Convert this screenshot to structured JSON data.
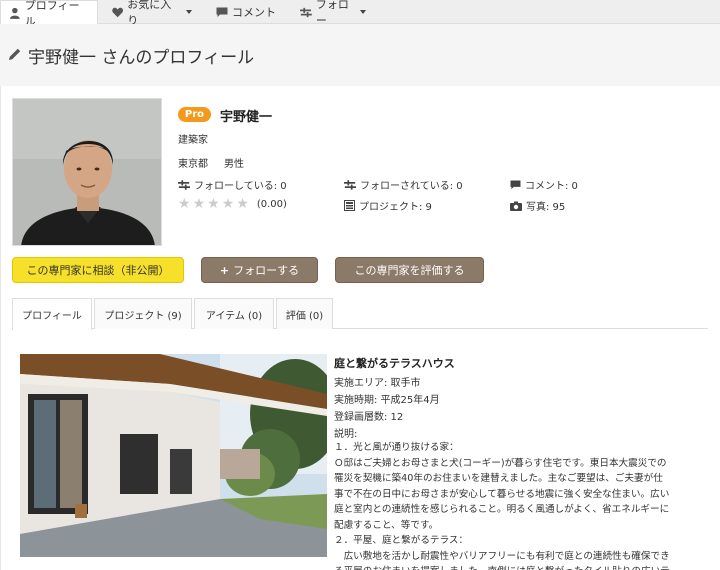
{
  "nav": {
    "tabs": [
      {
        "label": "プロフィール",
        "icon": "person-icon"
      },
      {
        "label": "お気に入り",
        "icon": "heart-icon"
      },
      {
        "label": "コメント",
        "icon": "comment-icon"
      },
      {
        "label": "フォロー",
        "icon": "follow-icon"
      }
    ]
  },
  "header": {
    "title": "宇野健一 さんのプロフィール"
  },
  "profile": {
    "badge": "Pro",
    "name": "宇野健一",
    "occupation": "建築家",
    "location": "東京都",
    "gender": "男性",
    "following": "フォローしている: 0",
    "followers": "フォローされている: 0",
    "comments": "コメント: 0",
    "rating": "(0.00)",
    "projects": "プロジェクト: 9",
    "photos": "写真: 95"
  },
  "buttons": {
    "consult": "この専門家に相談（非公開）",
    "follow": "フォローする",
    "evaluate": "この専門家を評価する"
  },
  "content_tabs": [
    {
      "label": "プロフィール"
    },
    {
      "label": "プロジェクト (9)"
    },
    {
      "label": "アイテム (0)"
    },
    {
      "label": "評価 (0)"
    }
  ],
  "project": {
    "title": "庭と繋がるテラスハウス",
    "area": "実施エリア: 取手市",
    "period": "実施時期: 平成25年4月",
    "photo_count": "登録画層数: 12",
    "description_label": "説明:",
    "description": "１．光と風が通り抜ける家：\nＯ邸はご夫婦とお母さまと犬(コーギー)が暮らす住宅です。東日本大震災での\n罹災を契機に築40年のお住まいを建替えました。主なご要望は、ご夫妻が仕\n事で不在の日中にお母さまが安心して暮らせる地震に強く安全な住まい。広い\n庭と室内との連続性を感じられること。明るく風通しがよく、省エネルギーに\n配慮すること、等です。\n２．平屋、庭と繋がるテラス：\n　広い敷地を活かし耐震性やバリアフリーにも有利で庭との連続性も確保でき\nる平屋のお住まいを提案しました。南側には庭と繋がったタイル貼りの広いテ"
  },
  "colors": {
    "pro_badge": "#f39a1d",
    "consult_button": "#f6e02a",
    "brown_button": "#8c7a69"
  }
}
